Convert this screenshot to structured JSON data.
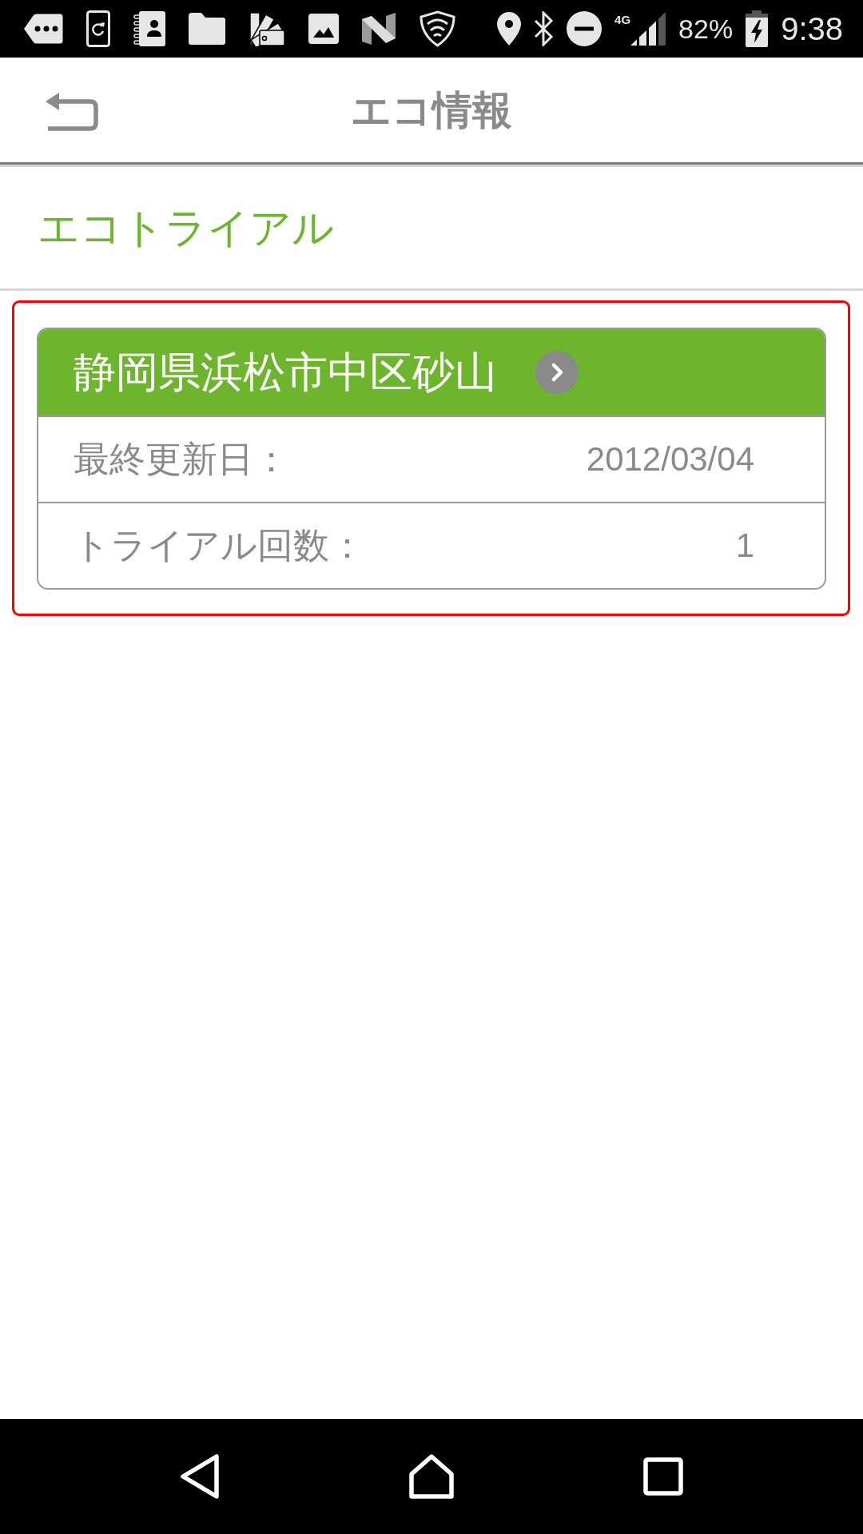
{
  "status_bar": {
    "network_type": "4G",
    "battery": "82%",
    "time": "9:38"
  },
  "app_bar": {
    "title": "エコ情報"
  },
  "section": {
    "title": "エコトライアル"
  },
  "card": {
    "highlighted": true,
    "title": "静岡県浜松市中区砂山",
    "rows": [
      {
        "label": "最終更新日：",
        "value": "2012/03/04"
      },
      {
        "label": "トライアル回数：",
        "value": "1"
      }
    ]
  }
}
